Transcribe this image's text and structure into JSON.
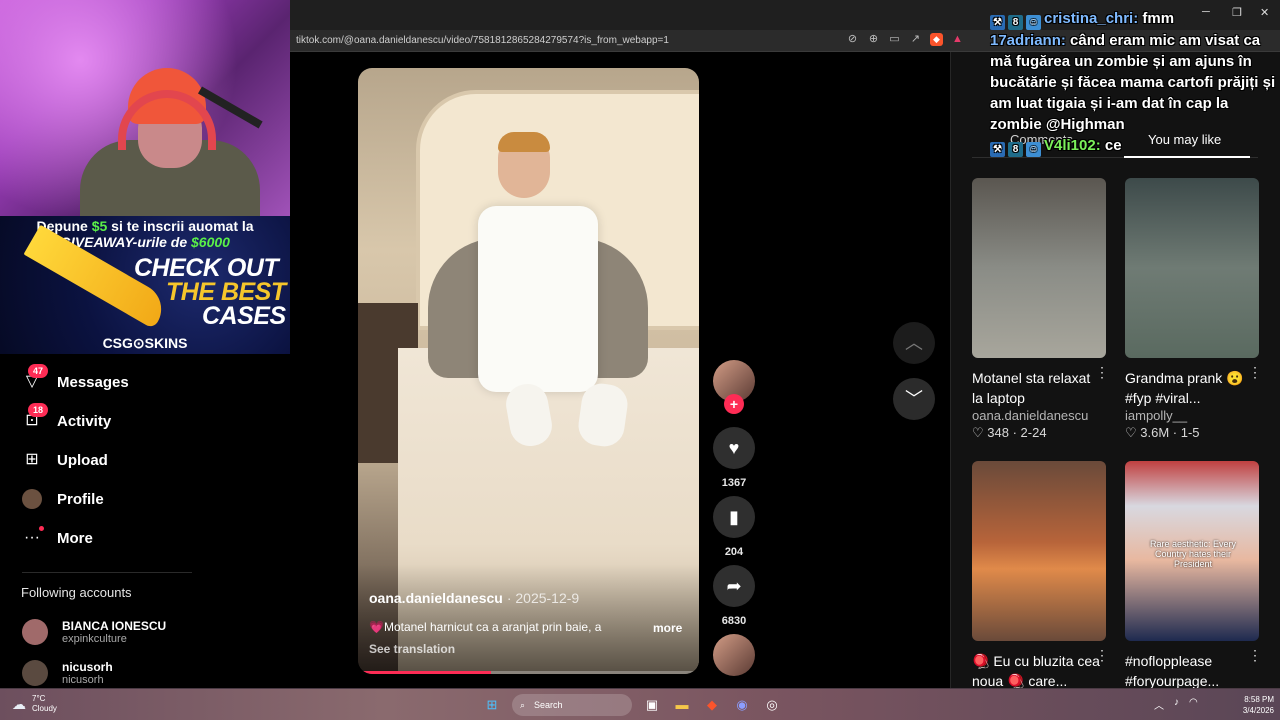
{
  "browser": {
    "url": "tiktok.com/@oana.danieldanescu/video/7581812865284279574?is_from_webapp=1"
  },
  "sidebar": {
    "items": [
      {
        "label": "Messages",
        "badge": "47",
        "icon": "paper-plane-icon"
      },
      {
        "label": "Activity",
        "badge": "18",
        "icon": "inbox-icon"
      },
      {
        "label": "Upload",
        "icon": "plus-square-icon"
      },
      {
        "label": "Profile",
        "icon": "avatar-icon"
      },
      {
        "label": "More",
        "icon": "more-dots-icon"
      }
    ],
    "following_header": "Following accounts",
    "accounts": [
      {
        "name": "BIANCA IONESCU",
        "username": "expinkculture"
      },
      {
        "name": "nicusorh",
        "username": "nicusorh"
      }
    ]
  },
  "promo": {
    "line1_pre": "Depune ",
    "line1_amount": "$5",
    "line1_post": " si te inscrii auomat la",
    "line2_pre": "GIVEAWAY-urile de ",
    "line2_amount": "$6000",
    "check": "CHECK OUT",
    "best": "THE BEST",
    "cases": "CASES",
    "brand": "CSG⊙SKINS"
  },
  "video": {
    "author": "oana.danieldanescu",
    "date": "· 2025-12-9",
    "description": "💗Motanel harnicut ca a aranjat prin baie, a",
    "more": "more",
    "see_translation": "See translation",
    "progress": 0.39
  },
  "actions": {
    "likes": "1367",
    "saves": "204",
    "shares": "6830"
  },
  "right_panel": {
    "tabs": [
      "Comments",
      "You may like"
    ],
    "active_tab": "You may like",
    "cards": [
      {
        "title": "Motanel sta relaxat la laptop",
        "author": "oana.danieldanescu",
        "likes": "348",
        "date": "2-24"
      },
      {
        "title": "Grandma prank 😮 #fyp #viral...",
        "author": "iampolly__",
        "likes": "3.6M",
        "date": "1-5"
      },
      {
        "title": "🪀 Eu cu bluzita cea noua 🪀 care...",
        "author": "",
        "likes": "",
        "date": ""
      },
      {
        "title": "#noflopplease #foryourpage...",
        "author": "",
        "likes": "",
        "date": "",
        "caption": "Rare aesthetic: Every Country hates their President"
      }
    ]
  },
  "chat": {
    "messages": [
      {
        "user": "cristina_chri:",
        "text": " fmm"
      },
      {
        "user": "17adriann:",
        "text": " când eram mic am visat ca mă fugărea un zombie și am ajuns în bucătărie și făcea mama cartofi prăjiți și am luat tigaia și i-am dat în cap la zombie @Highman"
      },
      {
        "user": "V4li102:",
        "text": " ce"
      }
    ]
  },
  "taskbar": {
    "temperature": "7°C",
    "weather": "Cloudy",
    "search": "Search",
    "time": "8:58 PM",
    "date": "3/4/2026"
  },
  "colors": {
    "accent": "#fe2c55",
    "panel": "#121212",
    "green_text": "#5af048"
  }
}
